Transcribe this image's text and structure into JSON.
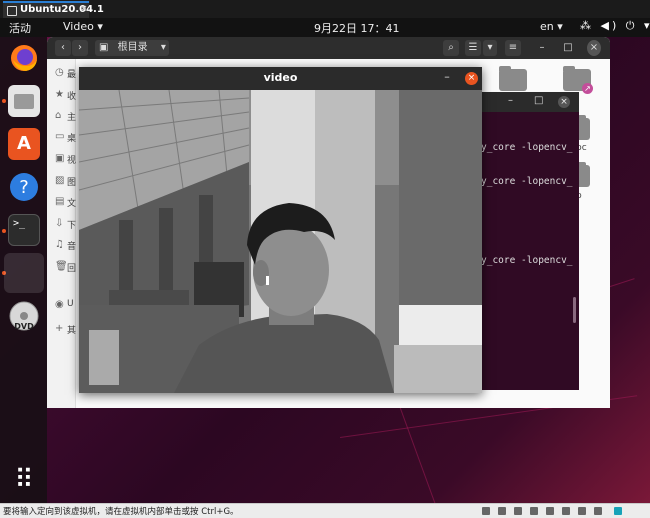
{
  "vm": {
    "tab_title": "Ubuntu20.04.1",
    "tab_close": "×",
    "status_text": "要将输入定向到该虚拟机，请在虚拟机内部单击或按 Ctrl+G。"
  },
  "topbar": {
    "activities": "活动",
    "app_menu": "Video ▾",
    "clock": "9月22日  17：41",
    "language": "en ▾",
    "tray": "⁂ ◀) ⏻ ▾"
  },
  "dock": {
    "items": [
      "firefox-icon",
      "files-icon",
      "software-icon",
      "help-icon",
      "terminal-icon",
      "app-icon",
      "dvd-icon"
    ],
    "show_apps": "⠿",
    "dvd_label": "DVD"
  },
  "files": {
    "nav_back": "‹",
    "nav_forward": "›",
    "location": "根目录",
    "location_caret": "▾",
    "search": "⌕",
    "view_list": "☰",
    "view_caret": "▾",
    "menu": "≡",
    "minimize": "–",
    "maximize": "□",
    "close": "×",
    "sidebar": [
      {
        "icon": "clock-icon",
        "glyph": "◷",
        "label": "最"
      },
      {
        "icon": "star-icon",
        "glyph": "★",
        "label": "收"
      },
      {
        "icon": "home-icon",
        "glyph": "⌂",
        "label": "主"
      },
      {
        "icon": "desktop-icon",
        "glyph": "▭",
        "label": "桌"
      },
      {
        "icon": "video-icon",
        "glyph": "▣",
        "label": "视"
      },
      {
        "icon": "picture-icon",
        "glyph": "▨",
        "label": "图"
      },
      {
        "icon": "document-icon",
        "glyph": "▤",
        "label": "文"
      },
      {
        "icon": "download-icon",
        "glyph": "⇩",
        "label": "下"
      },
      {
        "icon": "music-icon",
        "glyph": "♫",
        "label": "音"
      },
      {
        "icon": "trash-icon",
        "glyph": "🗑",
        "label": "回"
      },
      {
        "icon": "disc-icon",
        "glyph": "◉",
        "label": "U"
      },
      {
        "icon": "plus-icon",
        "glyph": "+",
        "label": "其"
      }
    ],
    "folder_labels": [
      "pc",
      "p"
    ]
  },
  "terminal": {
    "minimize": "–",
    "maximize": "□",
    "close": "×",
    "lines": [
      "y_core -lopencv_",
      "y_core -lopencv_",
      "y_core -lopencv_"
    ]
  },
  "video": {
    "title": "video",
    "minimize": "–",
    "close": "×"
  }
}
